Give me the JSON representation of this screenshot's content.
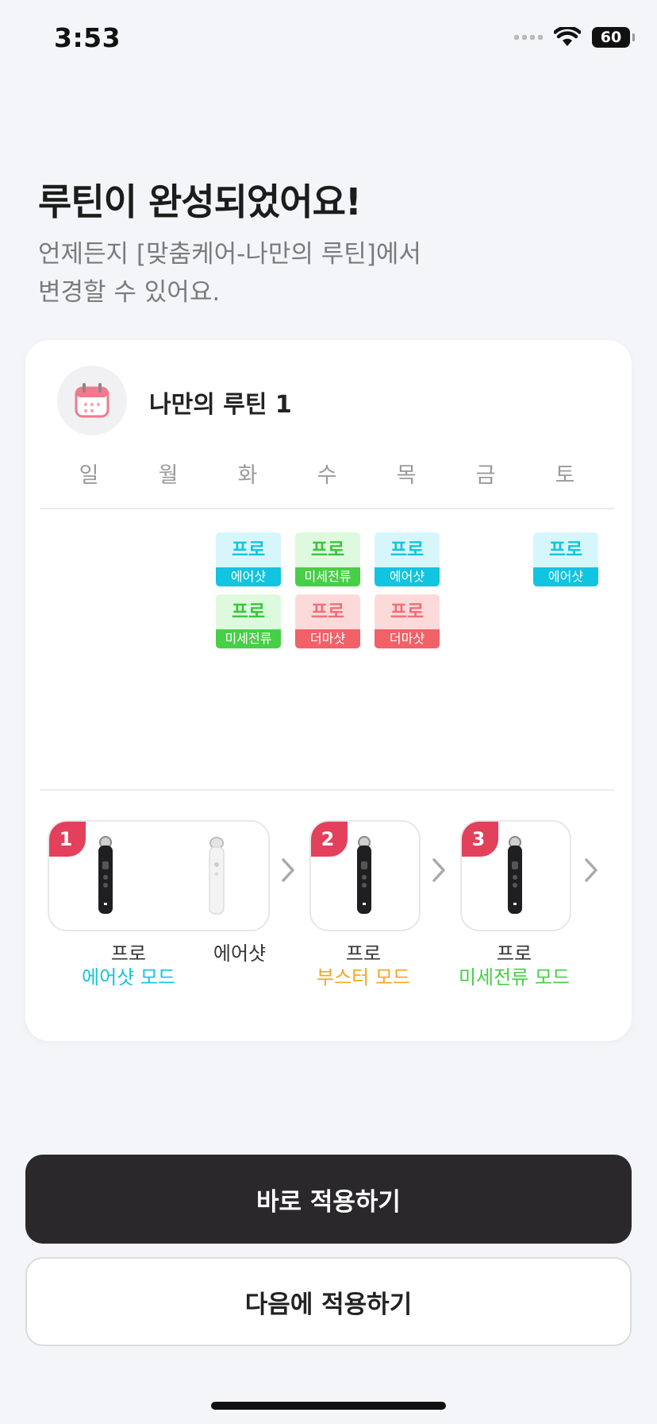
{
  "status_bar": {
    "time": "3:53",
    "battery": "60"
  },
  "headline": "루틴이 완성되었어요!",
  "subtitle_lines": [
    "언제든지 [맞춤케어-나만의 루틴]에서",
    "변경할 수 있어요."
  ],
  "routine_card": {
    "title": "나만의 루틴 1",
    "icon": "calendar-icon",
    "weekdays": [
      "일",
      "월",
      "화",
      "수",
      "목",
      "금",
      "토"
    ],
    "schedule": {
      "tue_1": {
        "device": "프로",
        "mode": "에어샷"
      },
      "tue_2": {
        "device": "프로",
        "mode": "미세전류"
      },
      "wed_1": {
        "device": "프로",
        "mode": "미세전류"
      },
      "wed_2": {
        "device": "프로",
        "mode": "더마샷"
      },
      "thu_1": {
        "device": "프로",
        "mode": "에어샷"
      },
      "thu_2": {
        "device": "프로",
        "mode": "더마샷"
      },
      "sat_1": {
        "device": "프로",
        "mode": "에어샷"
      }
    },
    "steps": [
      {
        "number": "1",
        "device_label": "프로",
        "mode_label": "에어샷 모드",
        "secondary_label": "에어샷"
      },
      {
        "number": "2",
        "device_label": "프로",
        "mode_label": "부스터 모드"
      },
      {
        "number": "3",
        "device_label": "프로",
        "mode_label": "미세전류 모드"
      }
    ]
  },
  "colors": {
    "airshot": "#11c4e0",
    "microcurrent": "#47cf47",
    "dermashot": "#f26068",
    "booster": "#f5a623",
    "step_badge": "#e2405b",
    "primary_button": "#2a282b"
  },
  "buttons": {
    "apply_now": "바로 적용하기",
    "apply_later": "다음에 적용하기"
  }
}
